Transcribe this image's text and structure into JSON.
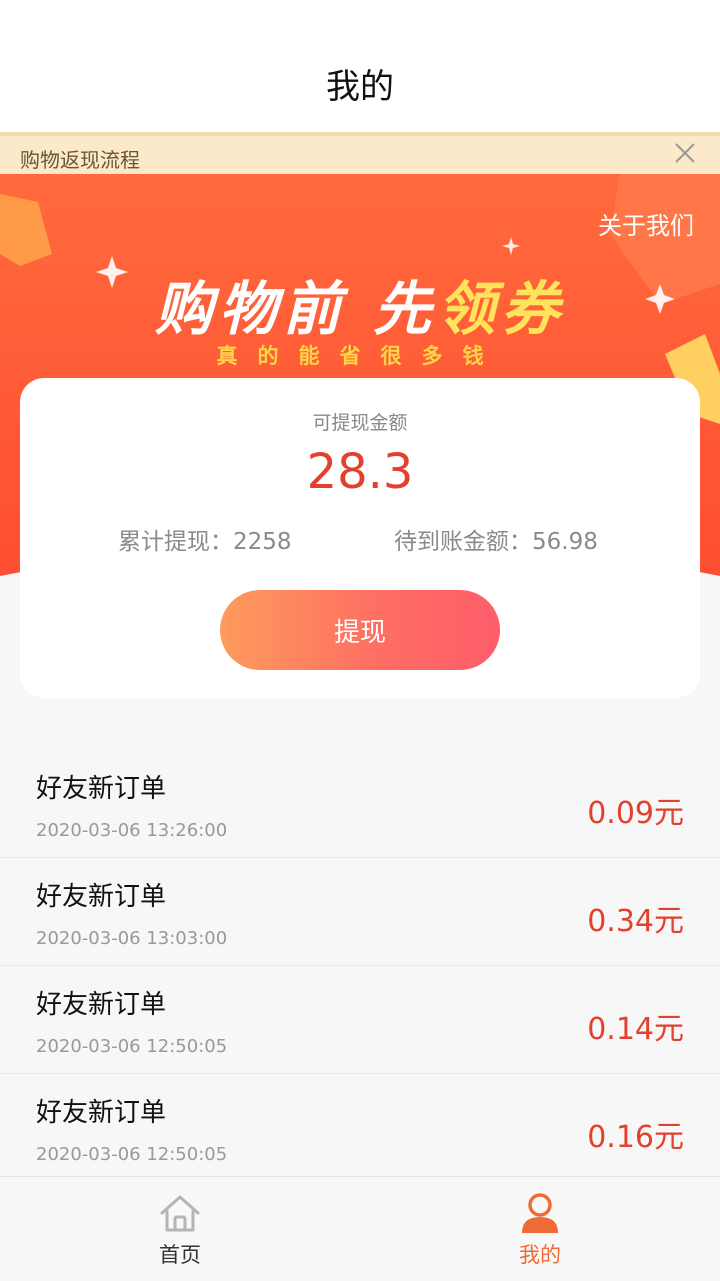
{
  "nav": {
    "title": "我的"
  },
  "notice": {
    "text": "购物返现流程"
  },
  "hero": {
    "about_link": "关于我们",
    "slogan_part1": "购物前 先",
    "slogan_part2": "领券",
    "subslogan": "真的能省很多钱"
  },
  "wallet": {
    "label": "可提现金额",
    "amount": "28.3",
    "total_withdrawn": "累计提现：2258",
    "pending": "待到账金额：56.98",
    "withdraw_button": "提现"
  },
  "orders": [
    {
      "title": "好友新订单",
      "time": "2020-03-06 13:26:00",
      "amount": "0.09元"
    },
    {
      "title": "好友新订单",
      "time": "2020-03-06 13:03:00",
      "amount": "0.34元"
    },
    {
      "title": "好友新订单",
      "time": "2020-03-06 12:50:05",
      "amount": "0.14元"
    },
    {
      "title": "好友新订单",
      "time": "2020-03-06 12:50:05",
      "amount": "0.16元"
    }
  ],
  "tabbar": {
    "home": {
      "label": "首页",
      "icon": "home-icon"
    },
    "mine": {
      "label": "我的",
      "icon": "user-icon",
      "active": true
    }
  },
  "colors": {
    "accent": "#e3412e",
    "hero_bg": "#ff5e38",
    "tab_active": "#ef6b36",
    "button_start": "#fd9b5c",
    "button_end": "#fe5d6a"
  }
}
